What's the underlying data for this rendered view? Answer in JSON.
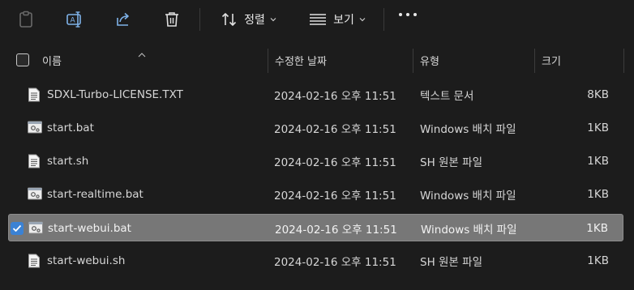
{
  "toolbar": {
    "sort_label": "정렬",
    "view_label": "보기"
  },
  "header": {
    "name": "이름",
    "modified": "수정한 날짜",
    "type": "유형",
    "size": "크기"
  },
  "files": [
    {
      "name": "SDXL-Turbo-LICENSE.TXT",
      "date": "2024-02-16 오후 11:51",
      "type": "텍스트 문서",
      "size": "8KB",
      "icon": "text-file-icon",
      "selected": false
    },
    {
      "name": "start.bat",
      "date": "2024-02-16 오후 11:51",
      "type": "Windows 배치 파일",
      "size": "1KB",
      "icon": "batch-file-icon",
      "selected": false
    },
    {
      "name": "start.sh",
      "date": "2024-02-16 오후 11:51",
      "type": "SH 원본 파일",
      "size": "1KB",
      "icon": "script-file-icon",
      "selected": false
    },
    {
      "name": "start-realtime.bat",
      "date": "2024-02-16 오후 11:51",
      "type": "Windows 배치 파일",
      "size": "1KB",
      "icon": "batch-file-icon",
      "selected": false
    },
    {
      "name": "start-webui.bat",
      "date": "2024-02-16 오후 11:51",
      "type": "Windows 배치 파일",
      "size": "1KB",
      "icon": "batch-file-icon",
      "selected": true
    },
    {
      "name": "start-webui.sh",
      "date": "2024-02-16 오후 11:51",
      "type": "SH 원본 파일",
      "size": "1KB",
      "icon": "script-file-icon",
      "selected": false
    }
  ]
}
